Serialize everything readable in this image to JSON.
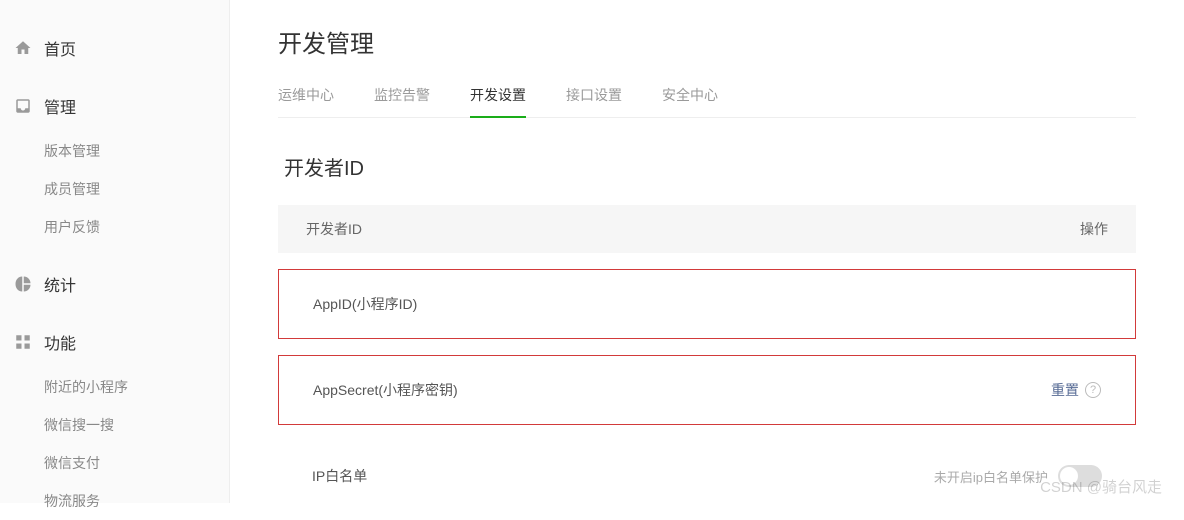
{
  "sidebar": {
    "home": "首页",
    "manage": {
      "label": "管理",
      "items": [
        "版本管理",
        "成员管理",
        "用户反馈"
      ]
    },
    "stats": "统计",
    "features": {
      "label": "功能",
      "items": [
        "附近的小程序",
        "微信搜一搜",
        "微信支付",
        "物流服务"
      ]
    }
  },
  "page": {
    "title": "开发管理"
  },
  "tabs": [
    "运维中心",
    "监控告警",
    "开发设置",
    "接口设置",
    "安全中心"
  ],
  "active_tab": "开发设置",
  "section": {
    "title": "开发者ID",
    "column_label": "开发者ID",
    "column_action": "操作"
  },
  "rows": {
    "appid": {
      "label": "AppID(小程序ID)",
      "value_placeholder": ""
    },
    "appsecret": {
      "label": "AppSecret(小程序密钥)",
      "action": "重置"
    },
    "ipwhitelist": {
      "label": "IP白名单",
      "status": "未开启ip白名单保护"
    }
  },
  "watermark": "CSDN @骑台风走"
}
